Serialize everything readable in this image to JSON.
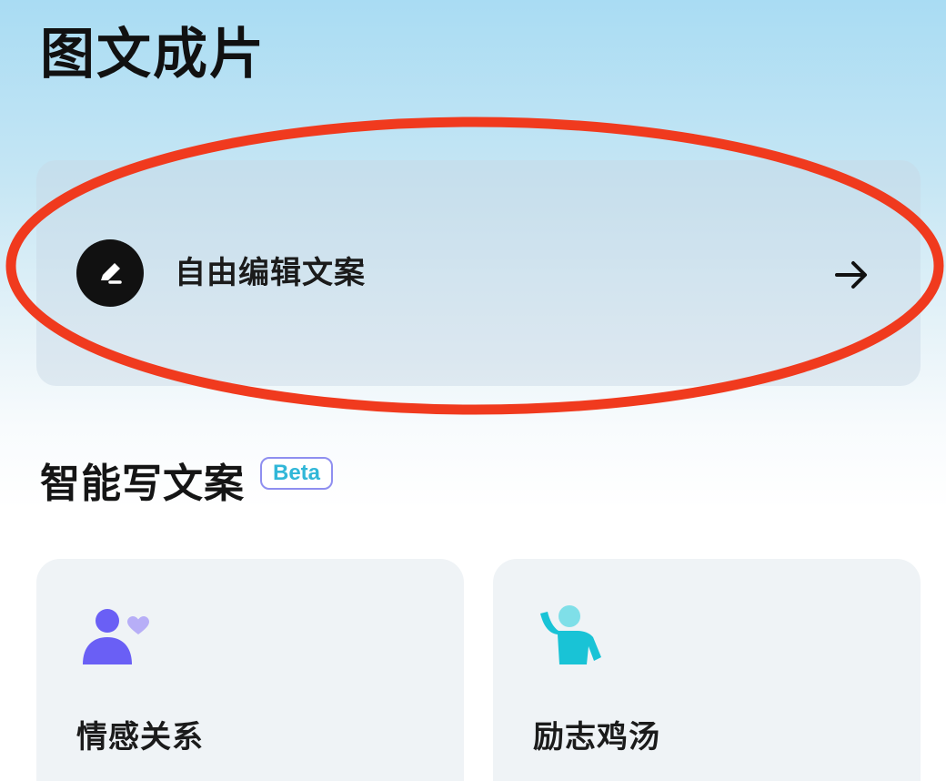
{
  "page": {
    "title": "图文成片"
  },
  "free_edit": {
    "icon": "pencil-icon",
    "label": "自由编辑文案",
    "arrow_icon": "arrow-right-icon"
  },
  "smart_write": {
    "title": "智能写文案",
    "badge": "Beta",
    "topics": [
      {
        "label": "情感关系",
        "icon": "person-heart-icon",
        "color": "#6a5ff5"
      },
      {
        "label": "励志鸡汤",
        "icon": "person-waving-icon",
        "color": "#19c3d6"
      }
    ]
  },
  "annotation": {
    "color": "#f03a1e"
  }
}
